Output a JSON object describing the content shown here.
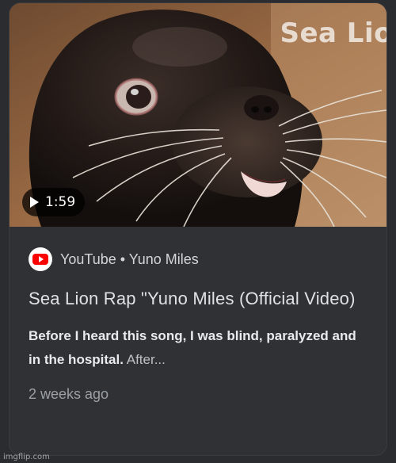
{
  "thumbnail": {
    "overlay_text": "Sea Lio",
    "duration": "1:59",
    "description": "sea lion close-up"
  },
  "source": {
    "icon": "youtube-icon",
    "label": "YouTube • Yuno Miles"
  },
  "title": "Sea Lion Rap \"Yuno Miles (Official Video)",
  "snippet": {
    "bold": "Before I heard this song, I was blind, paralyzed and in the hospital.",
    "rest": " After..."
  },
  "date": "2 weeks ago",
  "watermark": "imgflip.com",
  "colors": {
    "card_bg": "#303134",
    "title": "#dfe1e5",
    "muted": "#9aa0a6",
    "youtube_red": "#ff0000"
  }
}
